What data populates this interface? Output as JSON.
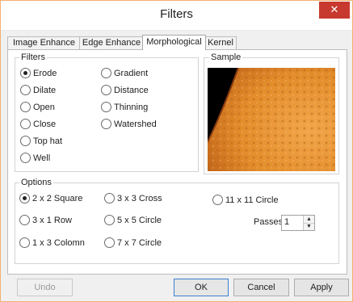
{
  "window": {
    "title": "Filters",
    "close_glyph": "✕"
  },
  "tabs": [
    {
      "label": "Image Enhance",
      "active": false
    },
    {
      "label": "Edge Enhance",
      "active": false
    },
    {
      "label": "Morphological",
      "active": true
    },
    {
      "label": "Kernel",
      "active": false
    }
  ],
  "filters_group": {
    "label": "Filters",
    "options": [
      {
        "label": "Erode",
        "checked": true
      },
      {
        "label": "Dilate",
        "checked": false
      },
      {
        "label": "Open",
        "checked": false
      },
      {
        "label": "Close",
        "checked": false
      },
      {
        "label": "Top hat",
        "checked": false
      },
      {
        "label": "Well",
        "checked": false
      },
      {
        "label": "Gradient",
        "checked": false
      },
      {
        "label": "Distance",
        "checked": false
      },
      {
        "label": "Thinning",
        "checked": false
      },
      {
        "label": "Watershed",
        "checked": false
      }
    ]
  },
  "sample": {
    "label": "Sample",
    "image_desc": "solar-surface-preview",
    "colors": {
      "sun": "#e8962e",
      "space": "#000000"
    }
  },
  "options_group": {
    "label": "Options",
    "options": [
      {
        "label": "2 x 2 Square",
        "checked": true
      },
      {
        "label": "3 x 1 Row",
        "checked": false
      },
      {
        "label": "1 x 3 Colomn",
        "checked": false
      },
      {
        "label": "3 x 3 Cross",
        "checked": false
      },
      {
        "label": "5 x 5 Circle",
        "checked": false
      },
      {
        "label": "7 x 7 Circle",
        "checked": false
      },
      {
        "label": "11 x 11 Circle",
        "checked": false
      }
    ],
    "passes": {
      "label": "Passes",
      "value": "1"
    }
  },
  "buttons": {
    "undo": "Undo",
    "ok": "OK",
    "cancel": "Cancel",
    "apply": "Apply"
  },
  "colors": {
    "window_border": "#f3b073",
    "close_button": "#c7392f",
    "default_button_border": "#3c7fd1"
  }
}
